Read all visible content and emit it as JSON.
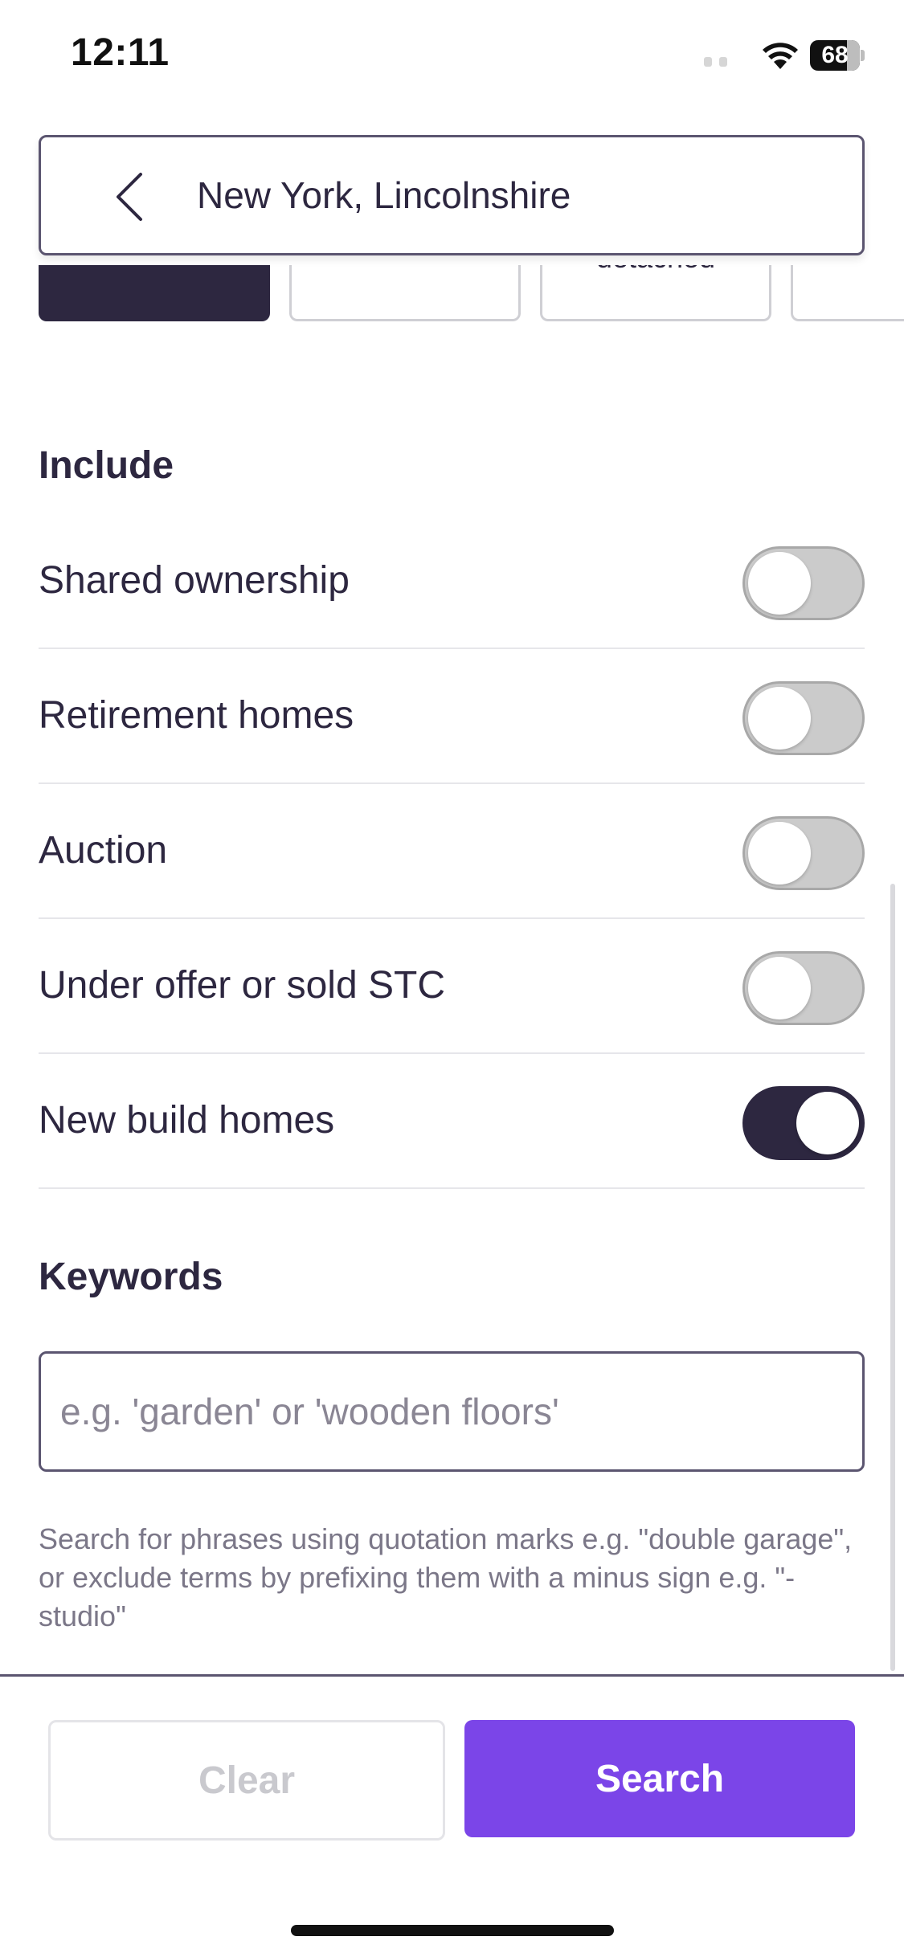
{
  "status_bar": {
    "time": "12:11",
    "battery_level": "68"
  },
  "location_bar": {
    "location": "New York, Lincolnshire"
  },
  "property_types": {
    "partial_chip_label": "detached"
  },
  "include": {
    "title": "Include",
    "options": [
      {
        "label": "Shared ownership",
        "enabled": false
      },
      {
        "label": "Retirement homes",
        "enabled": false
      },
      {
        "label": "Auction",
        "enabled": false
      },
      {
        "label": "Under offer or sold STC",
        "enabled": false
      },
      {
        "label": "New build homes",
        "enabled": true
      }
    ]
  },
  "keywords": {
    "title": "Keywords",
    "placeholder": "e.g. 'garden' or 'wooden floors'",
    "value": "",
    "help": "Search for phrases using quotation marks e.g. \"double garage\", or exclude terms by prefixing them with a minus sign e.g. \"-studio\""
  },
  "actions": {
    "clear_label": "Clear",
    "search_label": "Search"
  },
  "colors": {
    "brand_dark": "#2d2740",
    "accent_purple": "#7b45e8",
    "toggle_off": "#cbcbcb"
  }
}
